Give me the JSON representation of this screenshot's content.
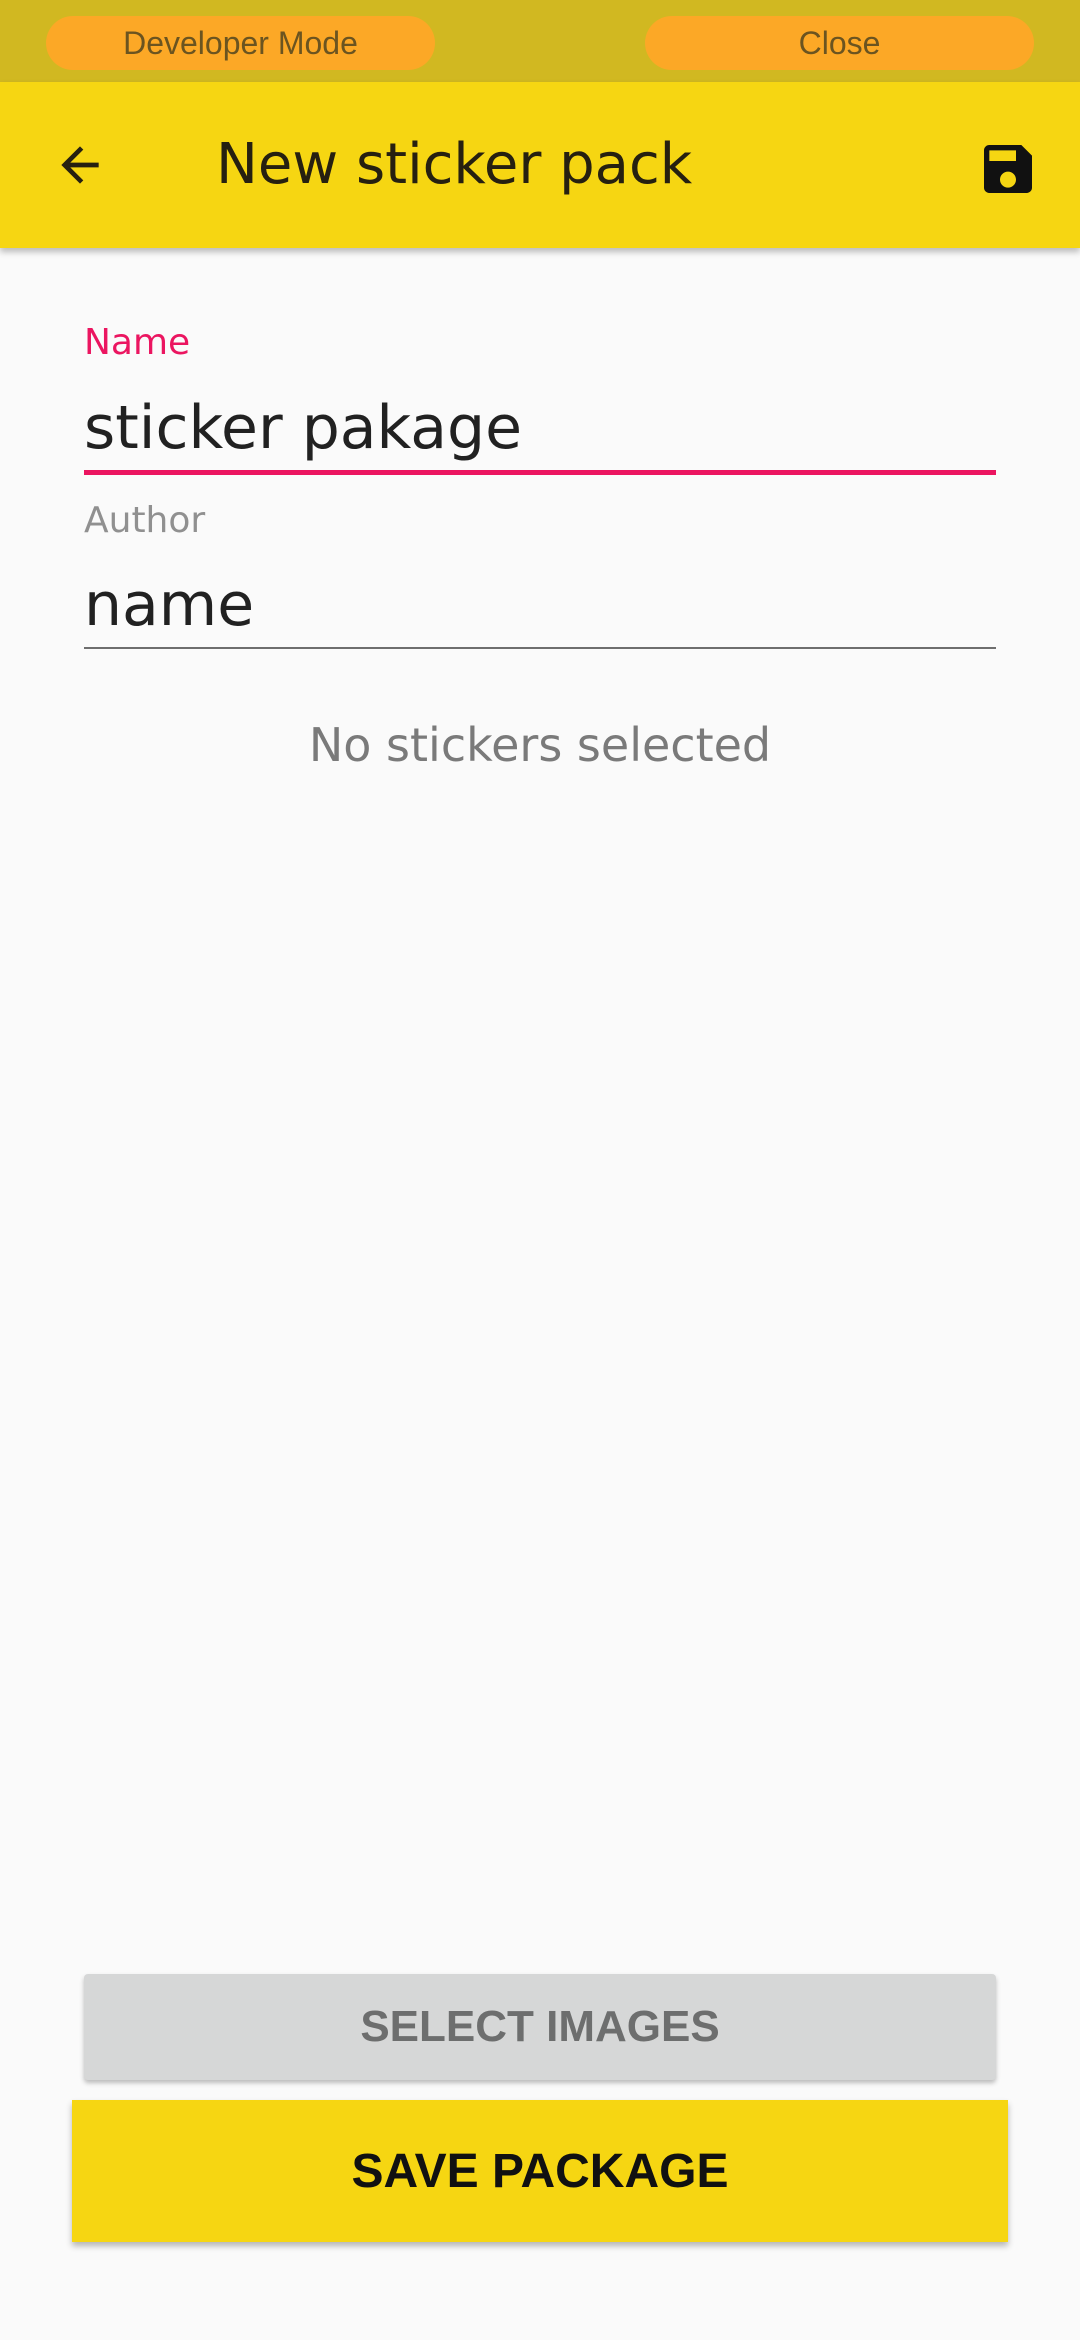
{
  "developer_bar": {
    "mode_label": "Developer Mode",
    "close_label": "Close"
  },
  "app_bar": {
    "title": "New sticker pack",
    "back_icon": "arrow-left-icon",
    "save_icon": "floppy-disk-icon"
  },
  "form": {
    "name_label": "Name",
    "name_value": "sticker pakage",
    "author_label": "Author",
    "author_value": "name"
  },
  "empty_state": "No stickers selected",
  "buttons": {
    "select_images": "SELECT IMAGES",
    "save_package": "SAVE PACKAGE"
  },
  "colors": {
    "app_bar": "#f6d612",
    "accent": "#eb1560",
    "dev_strip": "#d1b821",
    "dev_pill": "#fca826"
  }
}
